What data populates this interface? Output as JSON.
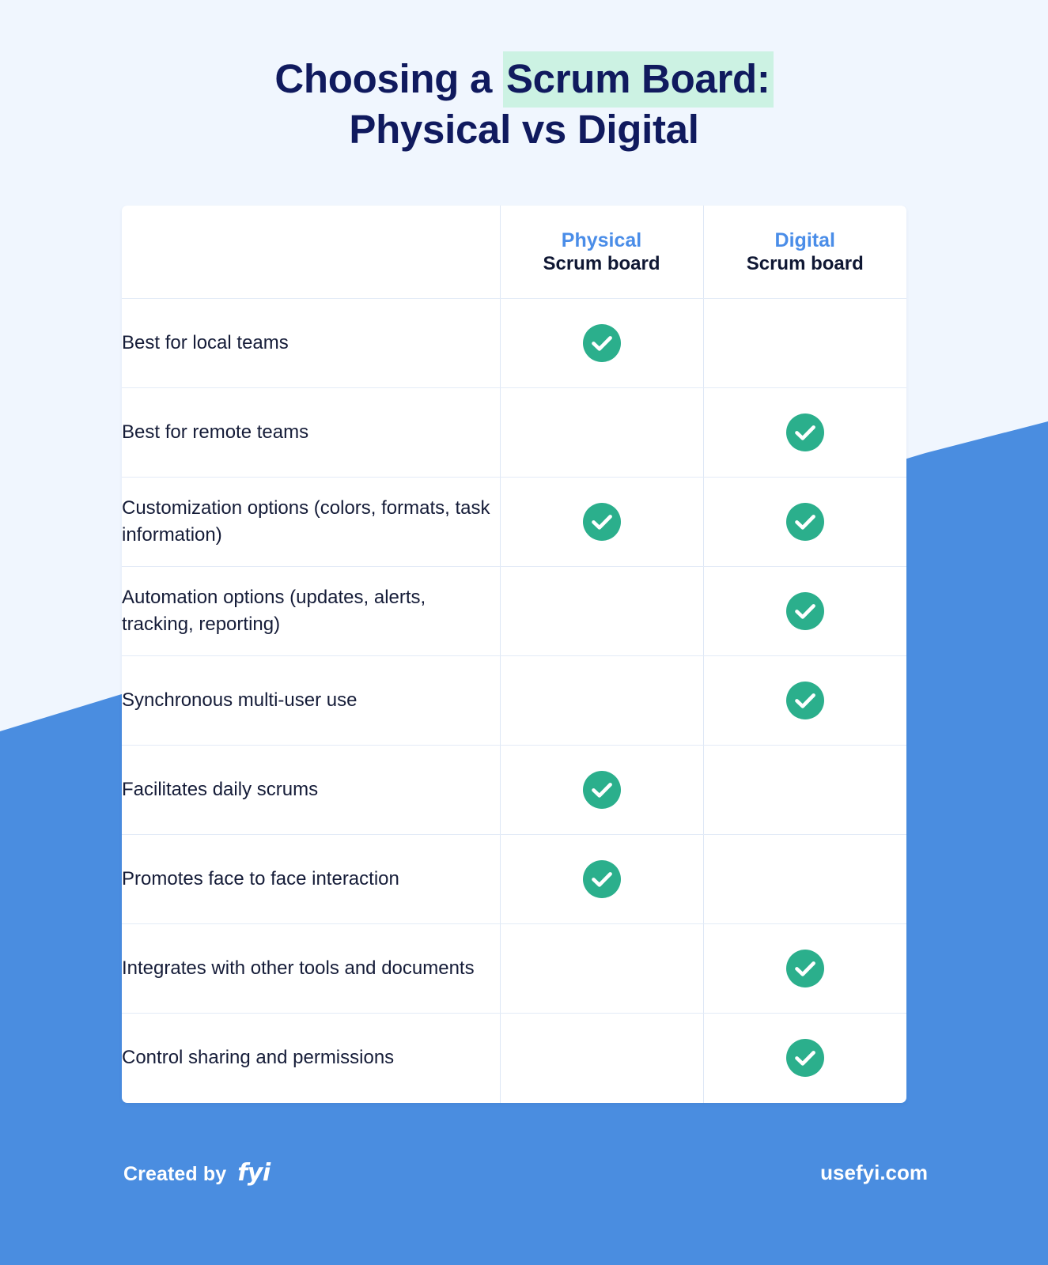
{
  "title": {
    "line1_prefix": "Choosing a ",
    "line1_highlight": "Scrum Board:",
    "line2": "Physical vs Digital"
  },
  "colors": {
    "page_background": "#F0F6FE",
    "accent_blue": "#4A8DE0",
    "header_blue": "#4A8DE8",
    "title_navy": "#101A5E",
    "highlight_mint": "#CCF2E3",
    "check_green": "#2BAF8C",
    "table_border": "#DDE7F5",
    "card_white": "#FFFFFF"
  },
  "table": {
    "columns": [
      {
        "kind": "",
        "sub": ""
      },
      {
        "kind": "Physical",
        "sub": "Scrum board"
      },
      {
        "kind": "Digital",
        "sub": "Scrum board"
      }
    ],
    "rows": [
      {
        "feature": "Best for local teams",
        "physical": true,
        "digital": false
      },
      {
        "feature": "Best for remote teams",
        "physical": false,
        "digital": true
      },
      {
        "feature": "Customization options (colors, formats, task information)",
        "physical": true,
        "digital": true
      },
      {
        "feature": "Automation options (updates, alerts, tracking, reporting)",
        "physical": false,
        "digital": true
      },
      {
        "feature": "Synchronous multi-user use",
        "physical": false,
        "digital": true
      },
      {
        "feature": "Facilitates daily scrums",
        "physical": true,
        "digital": false
      },
      {
        "feature": "Promotes face to face interaction",
        "physical": true,
        "digital": false
      },
      {
        "feature": "Integrates with other tools and documents",
        "physical": false,
        "digital": true
      },
      {
        "feature": "Control sharing and permissions",
        "physical": false,
        "digital": true
      }
    ]
  },
  "footer": {
    "created_by_label": "Created by",
    "brand": "fyi",
    "site_url": "usefyi.com"
  },
  "icons": {
    "check": "check-circle-icon"
  }
}
